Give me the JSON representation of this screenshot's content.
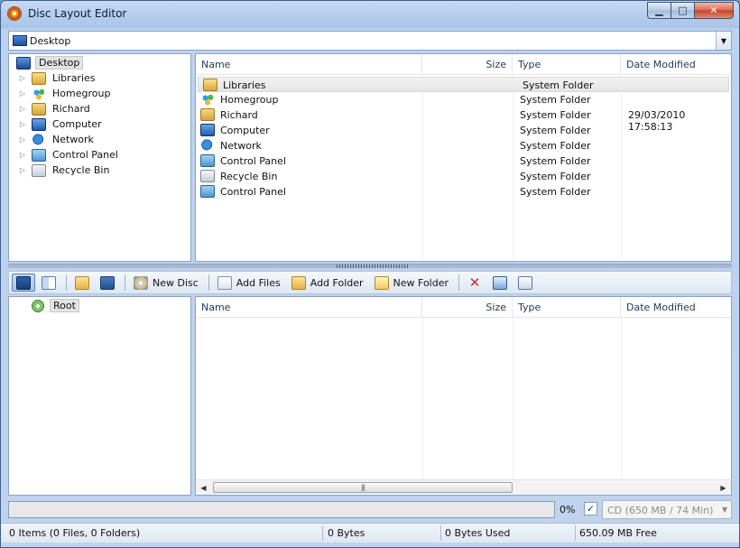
{
  "window": {
    "title": "Disc Layout Editor",
    "min_glyph": "▁",
    "max_glyph": "□",
    "close_glyph": "✕"
  },
  "address": {
    "value": "Desktop",
    "dropdown_glyph": "▼"
  },
  "tree_top": {
    "expander_glyph": "▷",
    "items": [
      {
        "label": "Desktop",
        "icon": "desktop-icon"
      },
      {
        "label": "Libraries",
        "icon": "libraries-icon"
      },
      {
        "label": "Homegroup",
        "icon": "homegroup-icon"
      },
      {
        "label": "Richard",
        "icon": "user-folder-icon"
      },
      {
        "label": "Computer",
        "icon": "computer-icon"
      },
      {
        "label": "Network",
        "icon": "network-icon"
      },
      {
        "label": "Control Panel",
        "icon": "control-panel-icon"
      },
      {
        "label": "Recycle Bin",
        "icon": "recycle-bin-icon"
      }
    ]
  },
  "list_top": {
    "columns": {
      "name": "Name",
      "size": "Size",
      "type": "Type",
      "date": "Date Modified"
    },
    "rows": [
      {
        "name": "Libraries",
        "type": "System Folder",
        "date": "",
        "icon": "libraries-icon"
      },
      {
        "name": "Homegroup",
        "type": "System Folder",
        "date": "",
        "icon": "homegroup-icon"
      },
      {
        "name": "Richard",
        "type": "System Folder",
        "date": "29/03/2010 17:58:13",
        "icon": "user-folder-icon"
      },
      {
        "name": "Computer",
        "type": "System Folder",
        "date": "",
        "icon": "computer-icon"
      },
      {
        "name": "Network",
        "type": "System Folder",
        "date": "",
        "icon": "network-icon"
      },
      {
        "name": "Control Panel",
        "type": "System Folder",
        "date": "",
        "icon": "control-panel-icon"
      },
      {
        "name": "Recycle Bin",
        "type": "System Folder",
        "date": "",
        "icon": "recycle-bin-icon"
      },
      {
        "name": "Control Panel",
        "type": "System Folder",
        "date": "",
        "icon": "control-panel-icon"
      }
    ]
  },
  "toolbar": {
    "new_disc": "New Disc",
    "add_files": "Add Files",
    "add_folder": "Add Folder",
    "new_folder": "New Folder",
    "delete_glyph": "✕"
  },
  "tree_bottom": {
    "root_label": "Root"
  },
  "list_bottom": {
    "columns": {
      "name": "Name",
      "size": "Size",
      "type": "Type",
      "date": "Date Modified"
    },
    "scroll_left": "◀",
    "scroll_right": "▶",
    "thumb_grip": "|||"
  },
  "progress": {
    "percent_label": "0%",
    "fraction": 0,
    "checkbox_glyph": "✓",
    "checked": true
  },
  "disc_type": {
    "value": "CD (650 MB / 74 Min)",
    "dropdown_glyph": "▼"
  },
  "status": {
    "items": "0 Items (0 Files, 0 Folders)",
    "bytes": "0 Bytes",
    "used": "0 Bytes Used",
    "free": "650.09 MB Free"
  },
  "colors": {
    "progress_fill": "#4aa52a",
    "window_frame": "#bcd2ef",
    "selection": "#e5e5e5"
  }
}
